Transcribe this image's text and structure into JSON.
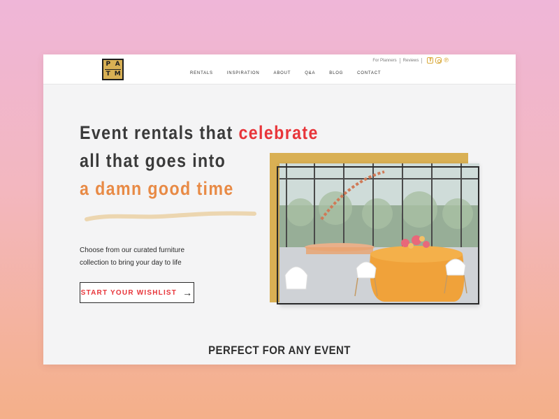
{
  "brand": {
    "logo_letters": [
      "P",
      "A",
      "T",
      "M"
    ],
    "gold": "#d9b054"
  },
  "utility": {
    "for_planners": "For Planners",
    "reviews": "Reviews",
    "icons": [
      "facebook-icon",
      "instagram-icon",
      "pinterest-icon"
    ]
  },
  "nav": {
    "items": [
      "RENTALS",
      "INSPIRATION",
      "ABOUT",
      "Q&A",
      "BLOG",
      "CONTACT"
    ]
  },
  "hero": {
    "line1_a": "Event rentals that ",
    "line1_b": "celebrate",
    "line2": "all that goes into",
    "line3": "a damn good time",
    "sub_line1": "Choose from our curated furniture",
    "sub_line2": "collection to bring your day to life",
    "cta": "START YOUR WISHLIST",
    "cta_arrow": "→"
  },
  "colors": {
    "red": "#e8353a",
    "orange": "#e88a45",
    "squiggle": "#ecd6b0",
    "dark": "#3a3a3a"
  },
  "section": {
    "title": "PERFECT FOR ANY EVENT"
  }
}
